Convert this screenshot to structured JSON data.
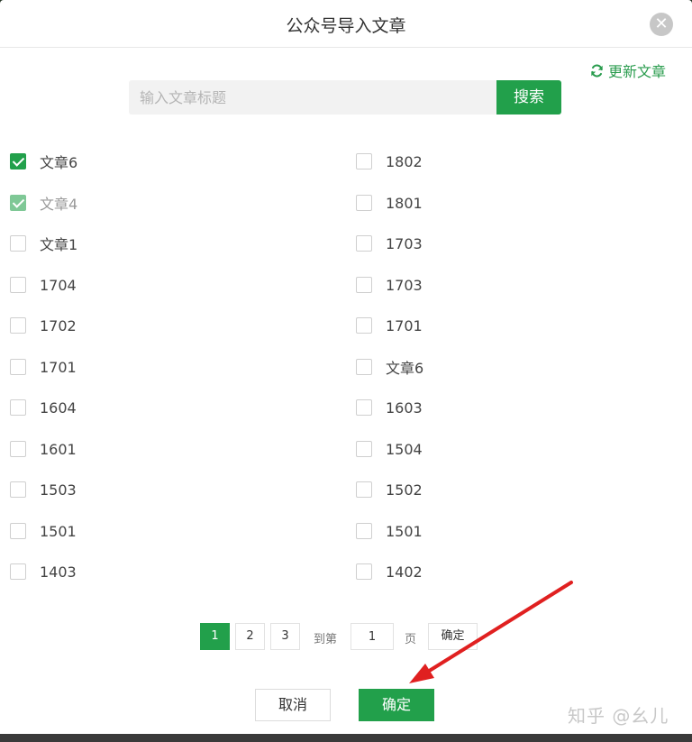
{
  "dialog": {
    "title": "公众号导入文章",
    "close_icon": "close-icon",
    "refresh_label": "更新文章",
    "refresh_icon": "refresh-icon"
  },
  "search": {
    "placeholder": "输入文章标题",
    "value": "",
    "button_label": "搜索"
  },
  "articles": {
    "left": [
      {
        "label": "文章6",
        "checked": true
      },
      {
        "label": "文章4",
        "checked": true
      },
      {
        "label": "文章1",
        "checked": false
      },
      {
        "label": "1704",
        "checked": false
      },
      {
        "label": "1702",
        "checked": false
      },
      {
        "label": "1701",
        "checked": false
      },
      {
        "label": "1604",
        "checked": false
      },
      {
        "label": "1601",
        "checked": false
      },
      {
        "label": "1503",
        "checked": false
      },
      {
        "label": "1501",
        "checked": false
      },
      {
        "label": "1403",
        "checked": false
      }
    ],
    "right": [
      {
        "label": "1802",
        "checked": false
      },
      {
        "label": "1801",
        "checked": false
      },
      {
        "label": "1703",
        "checked": false
      },
      {
        "label": "1703",
        "checked": false
      },
      {
        "label": "1701",
        "checked": false
      },
      {
        "label": "文章6",
        "checked": false
      },
      {
        "label": "1603",
        "checked": false
      },
      {
        "label": "1504",
        "checked": false
      },
      {
        "label": "1502",
        "checked": false
      },
      {
        "label": "1501",
        "checked": false
      },
      {
        "label": "1402",
        "checked": false
      }
    ]
  },
  "pager": {
    "pages": [
      "1",
      "2",
      "3"
    ],
    "current": "1",
    "goto_prefix": "到第",
    "goto_value": "1",
    "goto_suffix": "页",
    "goto_button": "确定"
  },
  "footer": {
    "cancel_label": "取消",
    "confirm_label": "确定"
  },
  "watermark": "知乎 @幺儿",
  "colors": {
    "accent": "#22a04b",
    "annotation_arrow": "#e02020"
  }
}
